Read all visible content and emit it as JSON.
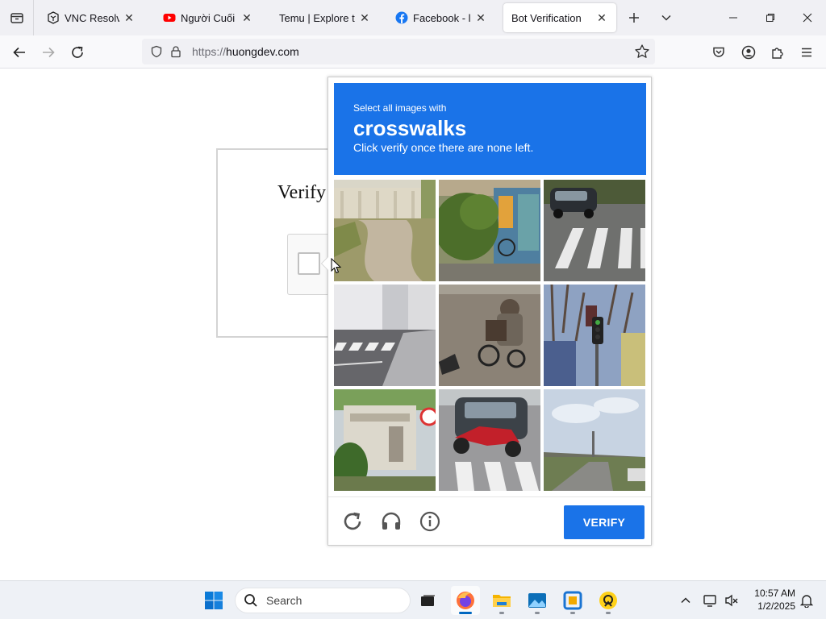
{
  "browser": {
    "tabs": [
      {
        "title": "VNC Resolver - I",
        "icon": "vnc-favicon"
      },
      {
        "title": "Người Cuối Cùn",
        "icon": "youtube-favicon"
      },
      {
        "title": "Temu | Explore the L",
        "icon": "temu-favicon"
      },
      {
        "title": "Facebook - log i",
        "icon": "facebook-favicon"
      },
      {
        "title": "Bot Verification",
        "icon": "none",
        "active": true
      }
    ],
    "url": {
      "protocol": "https://",
      "host": "huongdev.com"
    }
  },
  "page": {
    "heading": "Verify"
  },
  "captcha": {
    "instruction_small": "Select all images with",
    "target_word": "crosswalks",
    "instruction_sub": "Click verify once there are none left.",
    "verify_label": "VERIFY",
    "accent_color": "#1a73e8",
    "tiles": [
      {
        "content": "dirt path by wall"
      },
      {
        "content": "McDonald's mural with bush"
      },
      {
        "content": "car parked at crosswalk"
      },
      {
        "content": "street with crosswalk"
      },
      {
        "content": "person on cargo bike"
      },
      {
        "content": "traffic light and tree"
      },
      {
        "content": "building with speed sign"
      },
      {
        "content": "red motorcycle at crosswalk"
      },
      {
        "content": "road with bridge and sky"
      }
    ]
  },
  "taskbar": {
    "search_placeholder": "Search",
    "time": "10:57 AM",
    "date": "1/2/2025"
  }
}
